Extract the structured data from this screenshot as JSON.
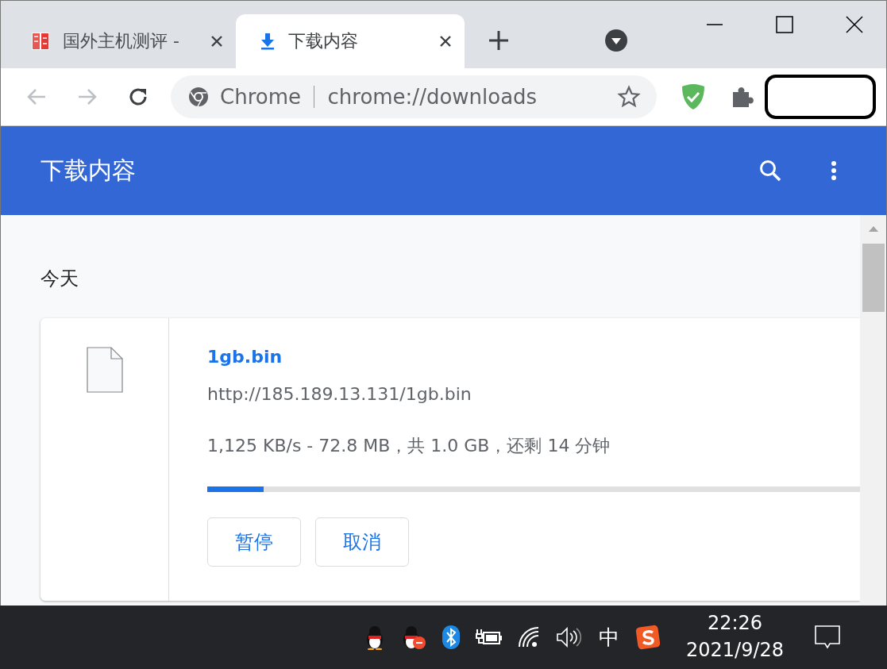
{
  "tabs": [
    {
      "title": "国外主机测评 -",
      "selected": false,
      "kind": "site"
    },
    {
      "title": "下载内容",
      "selected": true,
      "kind": "download"
    }
  ],
  "address_bar": {
    "site_label": "Chrome",
    "url": "chrome://downloads"
  },
  "header": {
    "title": "下载内容"
  },
  "section": {
    "title": "今天"
  },
  "download": {
    "file_name": "1gb.bin",
    "url": "http://185.189.13.131/1gb.bin",
    "status": "1,125 KB/s - 72.8 MB，共 1.0 GB，还剩 14 分钟",
    "level": 0.086,
    "buttons": [
      "暂停",
      "取消"
    ]
  },
  "taskbar": {
    "ime": "中",
    "time": "22:26",
    "date": "2021/9/28"
  }
}
